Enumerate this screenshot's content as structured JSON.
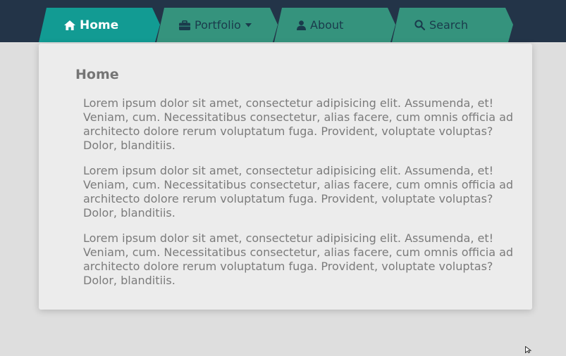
{
  "nav": {
    "tabs": [
      {
        "label": "Home",
        "icon": "home-icon",
        "active": true
      },
      {
        "label": "Portfolio",
        "icon": "briefcase-icon",
        "caret": "caret-down-icon",
        "active": false
      },
      {
        "label": "About",
        "icon": "user-icon",
        "active": false
      },
      {
        "label": "Search",
        "icon": "search-icon",
        "active": false
      }
    ]
  },
  "content": {
    "heading": "Home",
    "paragraphs": [
      "Lorem ipsum dolor sit amet, consectetur adipisicing elit. Assumenda, et! Veniam, cum. Necessitatibus consectetur, alias facere, cum omnis officia ad architecto dolore rerum voluptatum fuga. Provident, voluptate voluptas? Dolor, blanditiis.",
      "Lorem ipsum dolor sit amet, consectetur adipisicing elit. Assumenda, et! Veniam, cum. Necessitatibus consectetur, alias facere, cum omnis officia ad architecto dolore rerum voluptatum fuga. Provident, voluptate voluptas? Dolor, blanditiis.",
      "Lorem ipsum dolor sit amet, consectetur adipisicing elit. Assumenda, et! Veniam, cum. Necessitatibus consectetur, alias facere, cum omnis officia ad architecto dolore rerum voluptatum fuga. Provident, voluptate voluptas? Dolor, blanditiis."
    ]
  },
  "colors": {
    "topbar": "#233448",
    "tab_active": "#129b93",
    "tab_inactive": "#35937d",
    "tab_inactive_text": "#1a3b4c",
    "page_background": "#dedede",
    "panel_background": "#ececec",
    "text": "#7b7b7b"
  }
}
